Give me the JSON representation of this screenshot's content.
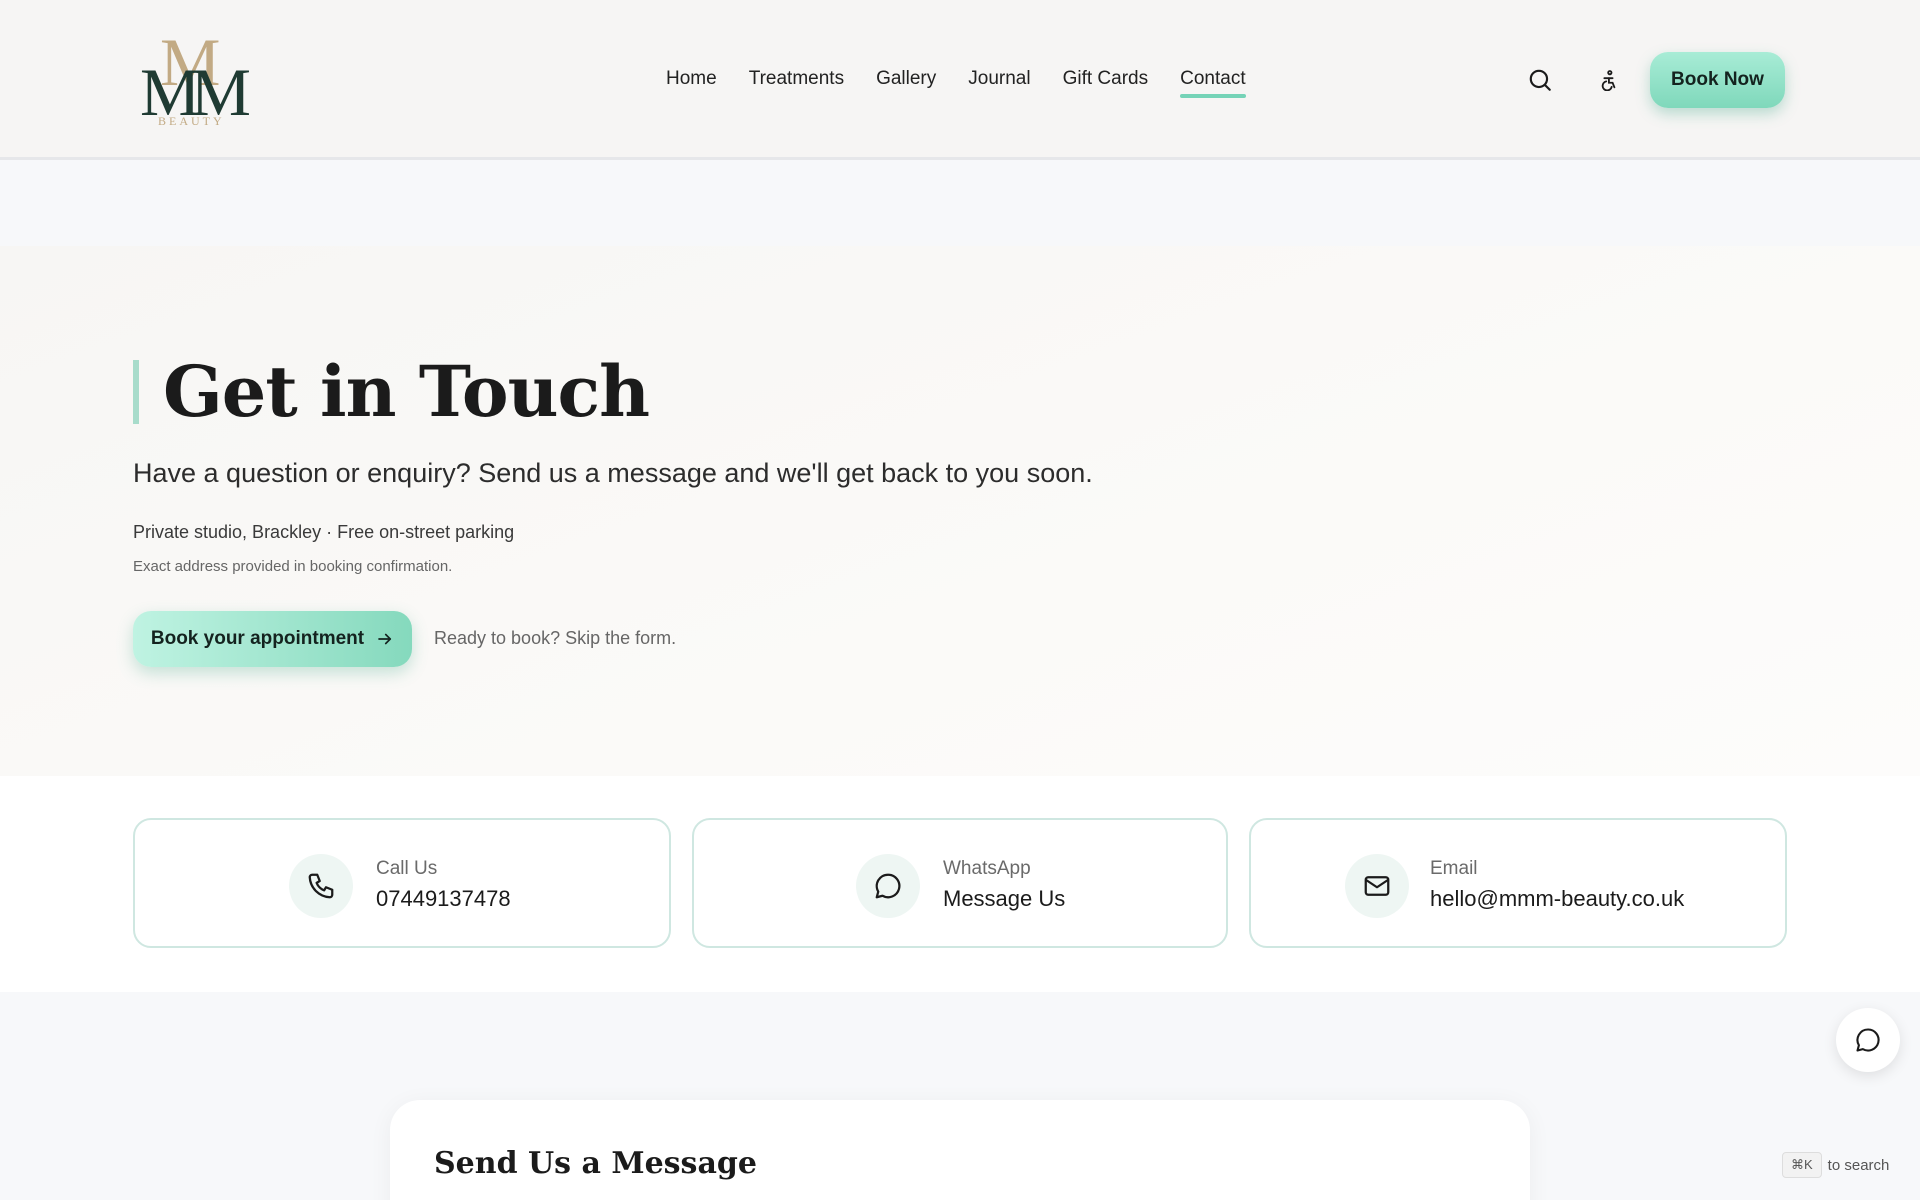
{
  "logo": {
    "letters": "MM",
    "back_letter": "M",
    "sub": "BEAUTY"
  },
  "nav": {
    "items": [
      {
        "label": "Home"
      },
      {
        "label": "Treatments"
      },
      {
        "label": "Gallery"
      },
      {
        "label": "Journal"
      },
      {
        "label": "Gift Cards"
      },
      {
        "label": "Contact",
        "active": true
      }
    ]
  },
  "header": {
    "search_icon": "search-icon",
    "accessibility_icon": "accessibility-icon",
    "book_now_label": "Book Now"
  },
  "hero": {
    "title": "Get in Touch",
    "subtitle": "Have a question or enquiry? Send us a message and we'll get back to you soon.",
    "location": "Private studio, Brackley · Free on-street parking",
    "note": "Exact address provided in booking confirmation.",
    "cta_label": "Book your appointment",
    "skip_text": "Ready to book? Skip the form."
  },
  "contact_cards": [
    {
      "icon": "phone-icon",
      "label": "Call Us",
      "value": "07449137478"
    },
    {
      "icon": "chat-bubble-icon",
      "label": "WhatsApp",
      "value": "Message Us"
    },
    {
      "icon": "mail-icon",
      "label": "Email",
      "value": "hello@mmm-beauty.co.uk"
    }
  ],
  "message_section": {
    "title": "Send Us a Message"
  },
  "search_hint": {
    "key": "⌘K",
    "text": "to search"
  },
  "colors": {
    "accent": "#75d3b7",
    "brand_dark": "#1f3b33",
    "brand_gold": "#c2aa84"
  }
}
